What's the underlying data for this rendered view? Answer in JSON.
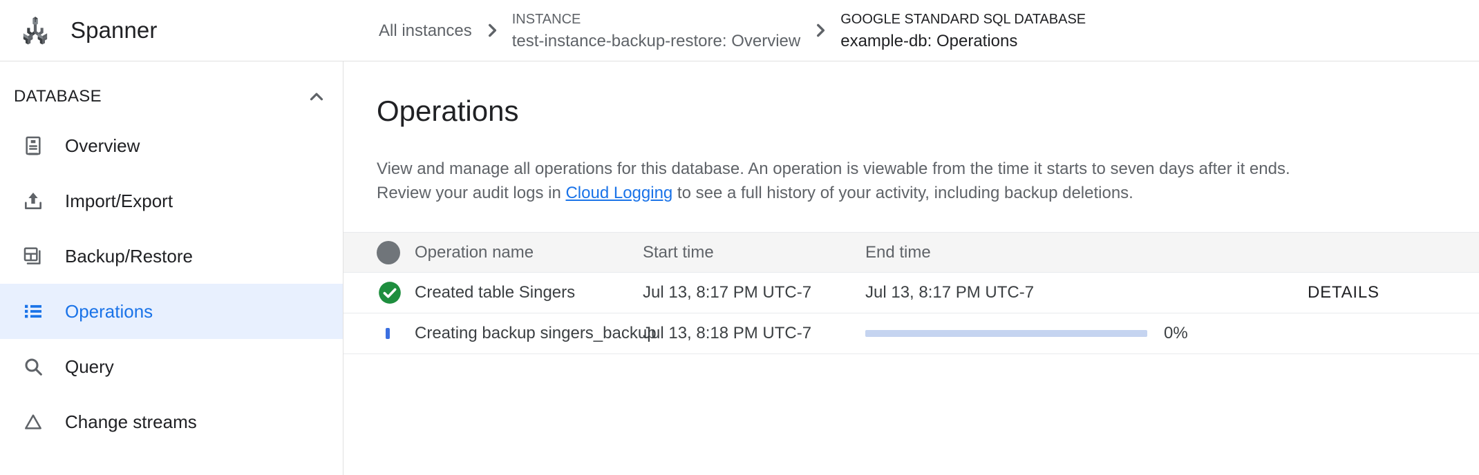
{
  "brand": {
    "title": "Spanner",
    "logo_icon": "spanner-wrench-icon"
  },
  "breadcrumb": {
    "root_label": "All instances",
    "separator_icon": "chevron-right-icon",
    "items": [
      {
        "eyebrow": "INSTANCE",
        "label": "test-instance-backup-restore: Overview",
        "current": false
      },
      {
        "eyebrow": "GOOGLE STANDARD SQL DATABASE",
        "label": "example-db: Operations",
        "current": true
      }
    ]
  },
  "sidebar": {
    "section_label": "DATABASE",
    "collapse_icon": "chevron-up-icon",
    "items": [
      {
        "label": "Overview",
        "icon": "document-icon",
        "active": false
      },
      {
        "label": "Import/Export",
        "icon": "upload-icon",
        "active": false
      },
      {
        "label": "Backup/Restore",
        "icon": "backup-restore-icon",
        "active": false
      },
      {
        "label": "Operations",
        "icon": "list-icon",
        "active": true
      },
      {
        "label": "Query",
        "icon": "search-icon",
        "active": false
      },
      {
        "label": "Change streams",
        "icon": "triangle-icon",
        "active": false
      }
    ]
  },
  "main": {
    "title": "Operations",
    "description_line1_before": "View and manage all operations for this database. An operation is viewable from the time it starts to seven days after it ends.",
    "description_line2_before": "Review your audit logs in ",
    "description_link": "Cloud Logging",
    "description_line2_after": " to see a full history of your activity, including backup deletions."
  },
  "table": {
    "columns": {
      "status": "",
      "name": "Operation name",
      "start": "Start time",
      "end": "End time",
      "action": ""
    },
    "header_status_icon": "filled-circle-icon",
    "rows": [
      {
        "status_icon": "check-circle-icon",
        "status_color": "#1e8e3e",
        "name": "Created table Singers",
        "start": "Jul 13, 8:17 PM UTC-7",
        "end": "Jul 13, 8:17 PM UTC-7",
        "action": "DETAILS",
        "has_progress": false
      },
      {
        "status_icon": "spinner-icon",
        "status_color": "#3b6fe0",
        "name": "Creating backup singers_backup",
        "start": "Jul 13, 8:18 PM UTC-7",
        "end": "",
        "action": "",
        "has_progress": true,
        "progress_percent": 0,
        "progress_label": "0%"
      }
    ]
  },
  "colors": {
    "accent_blue": "#1a73e8",
    "active_nav_bg": "#e8f0fe",
    "success_green": "#1e8e3e",
    "progress_track": "#c5d4f0",
    "text_primary": "#202124",
    "text_secondary": "#5f6368",
    "header_bg": "#f5f5f5"
  }
}
